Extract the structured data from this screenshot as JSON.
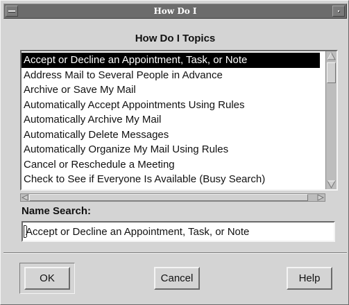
{
  "window": {
    "title": "How Do I"
  },
  "heading": "How Do I Topics",
  "topics": {
    "selected_index": 0,
    "items": [
      "Accept or Decline an Appointment, Task, or Note",
      "Address Mail to Several People in Advance",
      "Archive or Save My Mail",
      "Automatically Accept Appointments Using Rules",
      "Automatically Archive My Mail",
      "Automatically Delete Messages",
      "Automatically Organize My Mail Using Rules",
      "Cancel or Reschedule a Meeting",
      "Check to See if Everyone Is Available (Busy Search)"
    ]
  },
  "name_search": {
    "label": "Name Search:",
    "value": "Accept or Decline an Appointment, Task, or Note"
  },
  "buttons": {
    "ok": "OK",
    "cancel": "Cancel",
    "help": "Help"
  },
  "icons": {
    "window_menu": "window-menu-icon",
    "minimize": "minimize-icon",
    "scroll_up": "arrow-up-icon",
    "scroll_down": "arrow-down-icon",
    "scroll_left": "arrow-left-icon",
    "scroll_right": "arrow-right-icon"
  },
  "colors": {
    "selection_bg": "#000000",
    "selection_fg": "#ffffff",
    "titlebar": "#6c6c6c"
  }
}
